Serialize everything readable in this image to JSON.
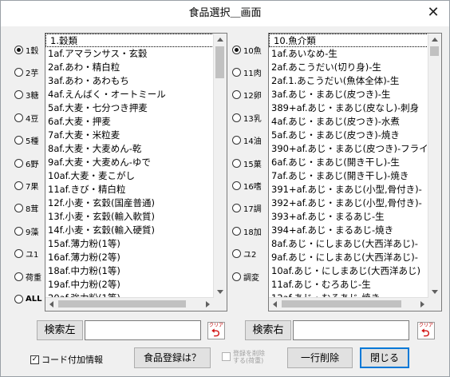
{
  "window": {
    "title": "食品選択＿画面",
    "close_glyph": "✕"
  },
  "left_radios": [
    {
      "label": "1穀",
      "selected": true
    },
    {
      "label": "2芋",
      "selected": false
    },
    {
      "label": "3糖",
      "selected": false
    },
    {
      "label": "4豆",
      "selected": false
    },
    {
      "label": "5種",
      "selected": false
    },
    {
      "label": "6野",
      "selected": false
    },
    {
      "label": "7果",
      "selected": false
    },
    {
      "label": "8茸",
      "selected": false
    },
    {
      "label": "9藻",
      "selected": false
    },
    {
      "label": "ユ1",
      "selected": false
    },
    {
      "label": "荷重",
      "selected": false
    },
    {
      "label": "ALL",
      "selected": false
    }
  ],
  "right_radios": [
    {
      "label": "10魚",
      "selected": true
    },
    {
      "label": "11肉",
      "selected": false
    },
    {
      "label": "12卵",
      "selected": false
    },
    {
      "label": "13乳",
      "selected": false
    },
    {
      "label": "14油",
      "selected": false
    },
    {
      "label": "15菓",
      "selected": false
    },
    {
      "label": "16嗜",
      "selected": false
    },
    {
      "label": "17調",
      "selected": false
    },
    {
      "label": "18加",
      "selected": false
    },
    {
      "label": "ユ2",
      "selected": false
    },
    {
      "label": "調変",
      "selected": false
    }
  ],
  "left_list": {
    "header": "1.穀類",
    "items": [
      "1af.アマランサス・玄穀",
      "2af.あわ・精白粒",
      "3af.あわ・あわもち",
      "4af.えんばく・オートミール",
      "5af.大麦・七分つき押麦",
      "6af.大麦・押麦",
      "7af.大麦・米粒麦",
      "8af.大麦・大麦めん-乾",
      "9af.大麦・大麦めん-ゆで",
      "10af.大麦・麦こがし",
      "11af.きび・精白粒",
      "12f.小麦・玄穀(国産普通)",
      "13f.小麦・玄穀(輸入軟質)",
      "14f.小麦・玄穀(輸入硬質)",
      "15af.薄力粉(1等)",
      "16af.薄力粉(2等)",
      "18af.中力粉(1等)",
      "19af.中力粉(2等)",
      "20af.強力粉(1等)",
      "21af.強力粉(2等)",
      "23af.強力粉(全粒粉)"
    ]
  },
  "right_list": {
    "header": "10.魚介類",
    "items": [
      "1af.あいなめ-生",
      "2af.あこうだい(切り身)-生",
      "2af.1.あこうだい(魚体全体)-生",
      "3af.あじ・まあじ(皮つき)-生",
      "389+af.あじ・まあじ(皮なし)-刺身",
      "4af.あじ・まあじ(皮つき)-水煮",
      "5af.あじ・まあじ(皮つき)-焼き",
      "390+af.あじ・まあじ(皮つき)-フライ",
      "6af.あじ・まあじ(開き干し)-生",
      "7af.あじ・まあじ(開き干し)-焼き",
      "391+af.あじ・まあじ(小型,骨付き)-",
      "392+af.あじ・まあじ(小型,骨付き)-",
      "393+af.あじ・まるあじ-生",
      "394+af.あじ・まるあじ-焼き",
      "8af.あじ・にしまあじ(大西洋あじ)-",
      "9af.あじ・にしまあじ(大西洋あじ)-",
      "10af.あじ・にしまあじ(大西洋あじ)",
      "11af.あじ・むろあじ-生",
      "12af.あじ・むろあじ-焼き",
      "13af.あじ・むろあじ-開き干し",
      "14f.あじ・むろあじ-くさや"
    ]
  },
  "search_left": {
    "button_label": "検索左",
    "value": ""
  },
  "search_right": {
    "button_label": "検索右",
    "value": ""
  },
  "clear_icon_text": "クリア",
  "bottom": {
    "code_info_label": "コード付加情報",
    "code_info_checked": true,
    "register_button": "食品登録は？",
    "delete_registration_label_1": "登録を削除",
    "delete_registration_label_2": "する(荷重)",
    "delete_line_button": "一行削除",
    "close_button": "閉じる"
  }
}
